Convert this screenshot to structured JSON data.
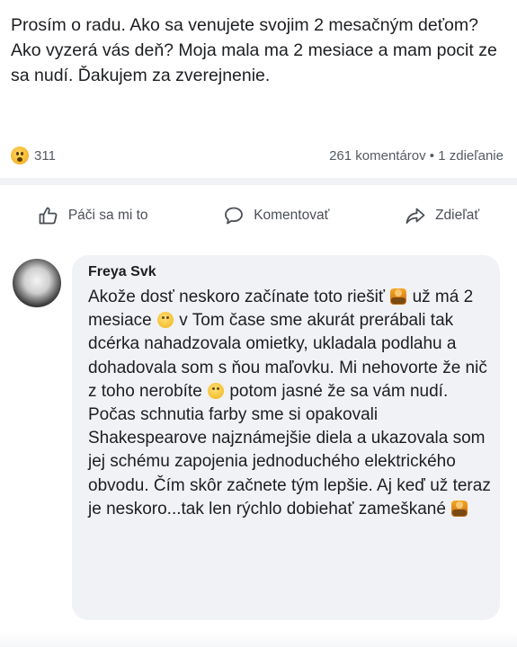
{
  "post": {
    "text": "Prosím o radu. Ako sa venujete svojim 2 mesačným deťom? Ako vyzerá vás deň? Moja mala ma 2 mesiace a mam pocit ze sa nudí. Ďakujem za zverejnenie."
  },
  "stats": {
    "reaction_icon": "haha-emoji-icon",
    "reaction_count": "311",
    "comments_shares": "261 komentárov • 1 zdieľanie"
  },
  "actions": {
    "like_label": "Páči sa mi to",
    "comment_label": "Komentovať",
    "share_label": "Zdieľať"
  },
  "comment": {
    "author": "Freya Svk",
    "segments": [
      "Akože dosť neskoro začínate toto riešiť ",
      " už má 2 mesiace ",
      " v Tom čase sme akurát prerábali tak dcérka nahadzovala omietky, ukladala podlahu a dohadovala som s ňou maľovku. Mi nehovorte že nič z toho nerobíte ",
      " potom jasné že sa vám nudí. Počas schnutia farby sme si opakovali Shakespearove najznámejšie diela a ukazovala som jej schému zapojenia jednoduchého elektrického obvodu. Čím skôr začnete tým lepšie. Aj keď už teraz je neskoro...tak len rýchlo dobiehať zameškané "
    ],
    "emoji_icons": [
      "shrug-emoji-icon",
      "smile-emoji-icon",
      "smile-emoji-icon",
      "shrug-emoji-icon"
    ]
  },
  "colors": {
    "text": "#1c1e21",
    "secondary": "#555a61",
    "bubble": "#f0f2f5",
    "divider": "#eceef1"
  }
}
